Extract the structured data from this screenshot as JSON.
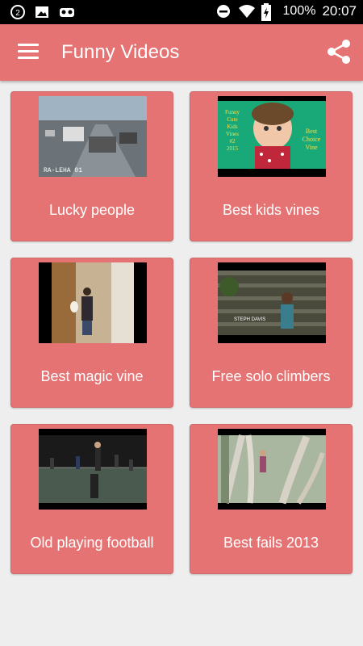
{
  "status_bar": {
    "battery": "100%",
    "time": "20:07",
    "icons": [
      "notification-badge-icon",
      "image-icon",
      "car-app-icon",
      "dnd-icon",
      "wifi-icon",
      "battery-charging-icon"
    ]
  },
  "app_bar": {
    "title": "Funny Videos",
    "left_icon": "menu-icon",
    "right_icon": "share-icon"
  },
  "thumb_texts": {
    "kids_line1": "Funny",
    "kids_line2": "Cute",
    "kids_line3": "Kids",
    "kids_line4": "Vines",
    "kids_line5": "#2",
    "kids_line6": "2015",
    "kids_right1": "Best",
    "kids_right2": "Choice",
    "kids_right3": "Vine",
    "lucky_stamp": "RA-LEHA 01",
    "climber_caption": "STEPH DAVIS"
  },
  "videos": [
    {
      "title": "Lucky people"
    },
    {
      "title": "Best kids vines"
    },
    {
      "title": "Best magic vine"
    },
    {
      "title": "Free solo climbers"
    },
    {
      "title": "Old playing football"
    },
    {
      "title": "Best fails 2013"
    }
  ],
  "colors": {
    "accent": "#e57373",
    "background": "#eeeeee",
    "status_bar": "#000000"
  }
}
